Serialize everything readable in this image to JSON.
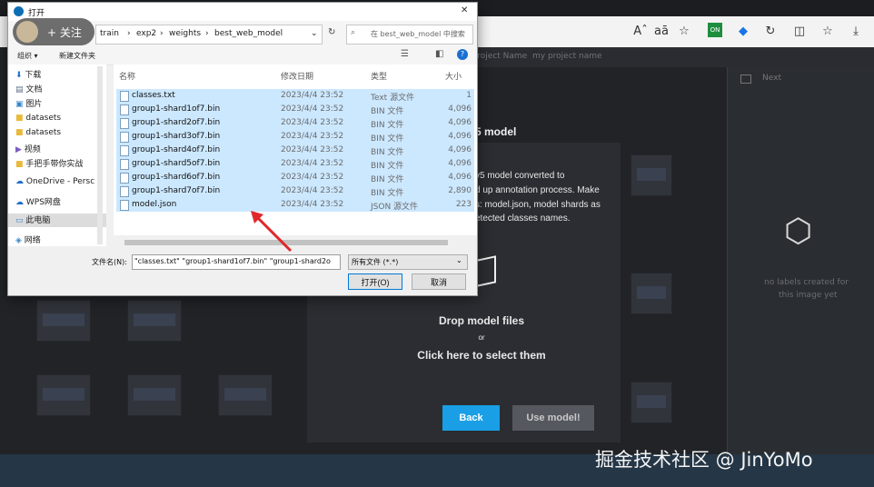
{
  "browser": {
    "icons": [
      "read-aloud-icon",
      "translate-icon",
      "favorite-add-icon",
      "extension-icon",
      "extension-icon",
      "refresh-icon",
      "split-screen-icon",
      "favorites-icon",
      "download-icon"
    ],
    "read_aloud": "Aˆ",
    "translate": "aā"
  },
  "dialog": {
    "title": "打开",
    "close": "✕",
    "address": {
      "path": [
        "train",
        "exp2",
        "weights",
        "best_web_model"
      ],
      "search_placeholder": "在 best_web_model 中搜索"
    },
    "toolbar": {
      "organize": "组织 ▾",
      "new_folder": "新建文件夹"
    },
    "nav": {
      "items": [
        "下载",
        "文档",
        "图片",
        "datasets",
        "datasets",
        "视频",
        "手把手带你实战",
        "OneDrive - Persc",
        "WPS网盘",
        "此电脑",
        "网络"
      ]
    },
    "columns": {
      "name": "名称",
      "date": "修改日期",
      "type": "类型",
      "size": "大小"
    },
    "files": [
      {
        "name": "classes.txt",
        "date": "2023/4/4 23:52",
        "type": "Text 源文件",
        "size": "1"
      },
      {
        "name": "group1-shard1of7.bin",
        "date": "2023/4/4 23:52",
        "type": "BIN 文件",
        "size": "4,096"
      },
      {
        "name": "group1-shard2of7.bin",
        "date": "2023/4/4 23:52",
        "type": "BIN 文件",
        "size": "4,096"
      },
      {
        "name": "group1-shard3of7.bin",
        "date": "2023/4/4 23:52",
        "type": "BIN 文件",
        "size": "4,096"
      },
      {
        "name": "group1-shard4of7.bin",
        "date": "2023/4/4 23:52",
        "type": "BIN 文件",
        "size": "4,096"
      },
      {
        "name": "group1-shard5of7.bin",
        "date": "2023/4/4 23:52",
        "type": "BIN 文件",
        "size": "4,096"
      },
      {
        "name": "group1-shard6of7.bin",
        "date": "2023/4/4 23:52",
        "type": "BIN 文件",
        "size": "4,096"
      },
      {
        "name": "group1-shard7of7.bin",
        "date": "2023/4/4 23:52",
        "type": "BIN 文件",
        "size": "2,890"
      },
      {
        "name": "model.json",
        "date": "2023/4/4 23:52",
        "type": "JSON 源文件",
        "size": "223"
      }
    ],
    "filename_label": "文件名(N):",
    "filename_value": "\"classes.txt\" \"group1-shard1of7.bin\" \"group1-shard2o",
    "filetype": "所有文件 (*.*)",
    "open_button": "打开(O)",
    "cancel_button": "取消"
  },
  "follow": {
    "label": "+ 关注"
  },
  "app": {
    "top_texts": [
      "Project Name",
      "my project name"
    ],
    "panel_tab": "Next",
    "modal_title_suffix": "5 model",
    "modal_lines": [
      "v5 model converted to",
      "d up annotation process. Make",
      "s: model.json, model shards as",
      "etected classes names."
    ],
    "drop_title": "Drop model files",
    "drop_or": "or",
    "drop_click": "Click here to select them",
    "back_button": "Back",
    "use_button": "Use model!",
    "no_labels_lines": [
      "no labels created for",
      "this image yet"
    ]
  },
  "watermark": "掘金技术社区 @ JinYoMo",
  "colors": {
    "accent": "#1a9fe6",
    "selection": "#cce8ff",
    "arrow": "#e0282a"
  }
}
